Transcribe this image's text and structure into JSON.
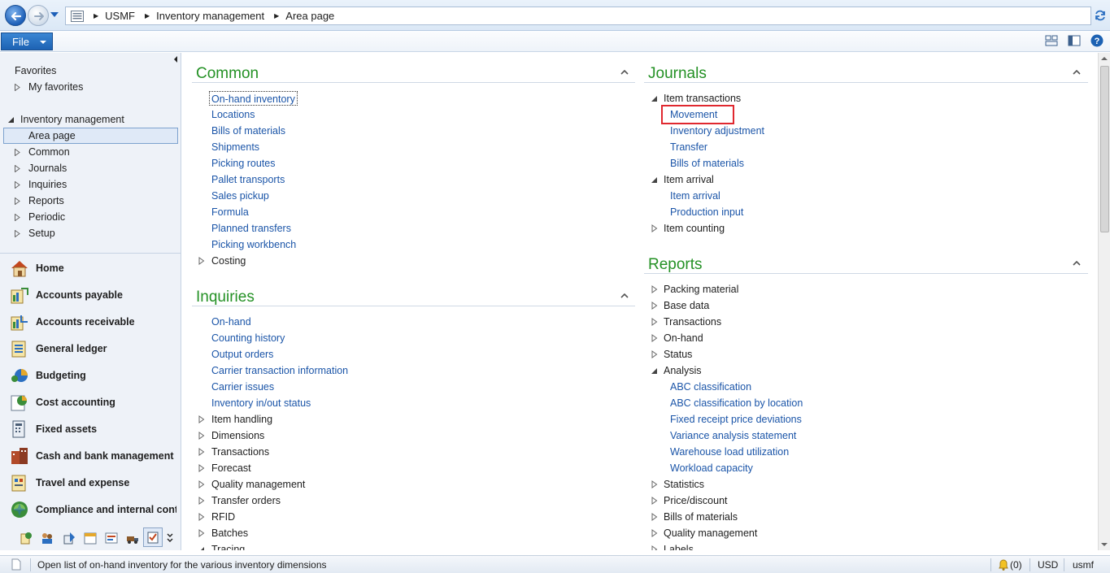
{
  "address": {
    "breadcrumb": [
      "USMF",
      "Inventory management",
      "Area page"
    ]
  },
  "ribbon": {
    "file_label": "File"
  },
  "navpane": {
    "favorites_label": "Favorites",
    "my_favorites_label": "My favorites",
    "module_label": "Inventory management",
    "items": [
      "Area page",
      "Common",
      "Journals",
      "Inquiries",
      "Reports",
      "Periodic",
      "Setup"
    ],
    "modules": [
      {
        "label": "Home",
        "icon": "home-icon"
      },
      {
        "label": "Accounts payable",
        "icon": "accounts-payable-icon"
      },
      {
        "label": "Accounts receivable",
        "icon": "accounts-receivable-icon"
      },
      {
        "label": "General ledger",
        "icon": "general-ledger-icon"
      },
      {
        "label": "Budgeting",
        "icon": "budgeting-icon"
      },
      {
        "label": "Cost accounting",
        "icon": "cost-accounting-icon"
      },
      {
        "label": "Fixed assets",
        "icon": "fixed-assets-icon"
      },
      {
        "label": "Cash and bank management",
        "icon": "cash-bank-icon"
      },
      {
        "label": "Travel and expense",
        "icon": "travel-expense-icon"
      },
      {
        "label": "Compliance and internal cont...",
        "icon": "compliance-icon"
      }
    ]
  },
  "common": {
    "title": "Common",
    "links": [
      "On-hand inventory",
      "Locations",
      "Bills of materials",
      "Shipments",
      "Picking routes",
      "Pallet transports",
      "Sales pickup",
      "Formula",
      "Planned transfers",
      "Picking workbench"
    ],
    "groups": [
      "Costing"
    ]
  },
  "inquiries": {
    "title": "Inquiries",
    "links": [
      "On-hand",
      "Counting history",
      "Output orders",
      "Carrier transaction information",
      "Carrier issues",
      "Inventory in/out status"
    ],
    "groups": [
      "Item handling",
      "Dimensions",
      "Transactions",
      "Forecast",
      "Quality management",
      "Transfer orders",
      "RFID",
      "Batches",
      "Tracing"
    ]
  },
  "journals": {
    "title": "Journals",
    "item_transactions": "Item transactions",
    "item_transactions_links": [
      "Movement",
      "Inventory adjustment",
      "Transfer",
      "Bills of materials"
    ],
    "item_arrival": "Item arrival",
    "item_arrival_links": [
      "Item arrival",
      "Production input"
    ],
    "item_counting": "Item counting"
  },
  "reports": {
    "title": "Reports",
    "groups_before": [
      "Packing material",
      "Base data",
      "Transactions",
      "On-hand",
      "Status"
    ],
    "analysis": "Analysis",
    "analysis_links": [
      "ABC classification",
      "ABC classification by location",
      "Fixed receipt price deviations",
      "Variance analysis statement",
      "Warehouse load utilization",
      "Workload capacity"
    ],
    "groups_after": [
      "Statistics",
      "Price/discount",
      "Bills of materials",
      "Quality management",
      "Labels"
    ]
  },
  "status": {
    "message": "Open list of on-hand inventory for the various inventory dimensions",
    "notifications": "(0)",
    "currency": "USD",
    "company": "usmf"
  },
  "colors": {
    "section_title": "#249125",
    "link": "#1b55a8",
    "highlight_box": "#e0282f"
  }
}
